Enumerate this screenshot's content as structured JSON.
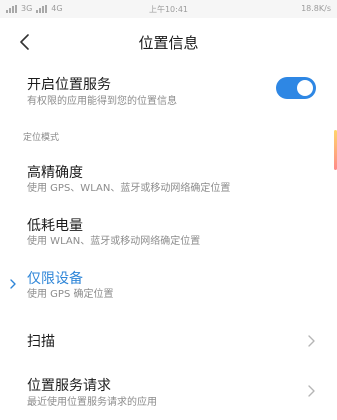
{
  "status_bar": {
    "signal_1": "3G",
    "signal_2": "4G",
    "time": "上午10:41",
    "net_speed": "18.8K/s"
  },
  "header": {
    "back_icon": "chevron-left-icon",
    "title": "位置信息"
  },
  "location_service": {
    "title": "开启位置服务",
    "subtitle": "有权限的应用能得到您的位置信息",
    "enabled": true,
    "accent_color": "#2e87e4"
  },
  "mode_section": {
    "label": "定位模式",
    "options": [
      {
        "title": "高精确度",
        "subtitle": "使用 GPS、WLAN、蓝牙或移动网络确定位置",
        "selected": false
      },
      {
        "title": "低耗电量",
        "subtitle": "使用 WLAN、蓝牙或移动网络确定位置",
        "selected": false
      },
      {
        "title": "仅限设备",
        "subtitle": "使用 GPS 确定位置",
        "selected": true
      }
    ],
    "selected_color": "#2f86d8"
  },
  "scan": {
    "title": "扫描"
  },
  "requests": {
    "title": "位置服务请求",
    "subtitle": "最近使用位置服务请求的应用"
  }
}
